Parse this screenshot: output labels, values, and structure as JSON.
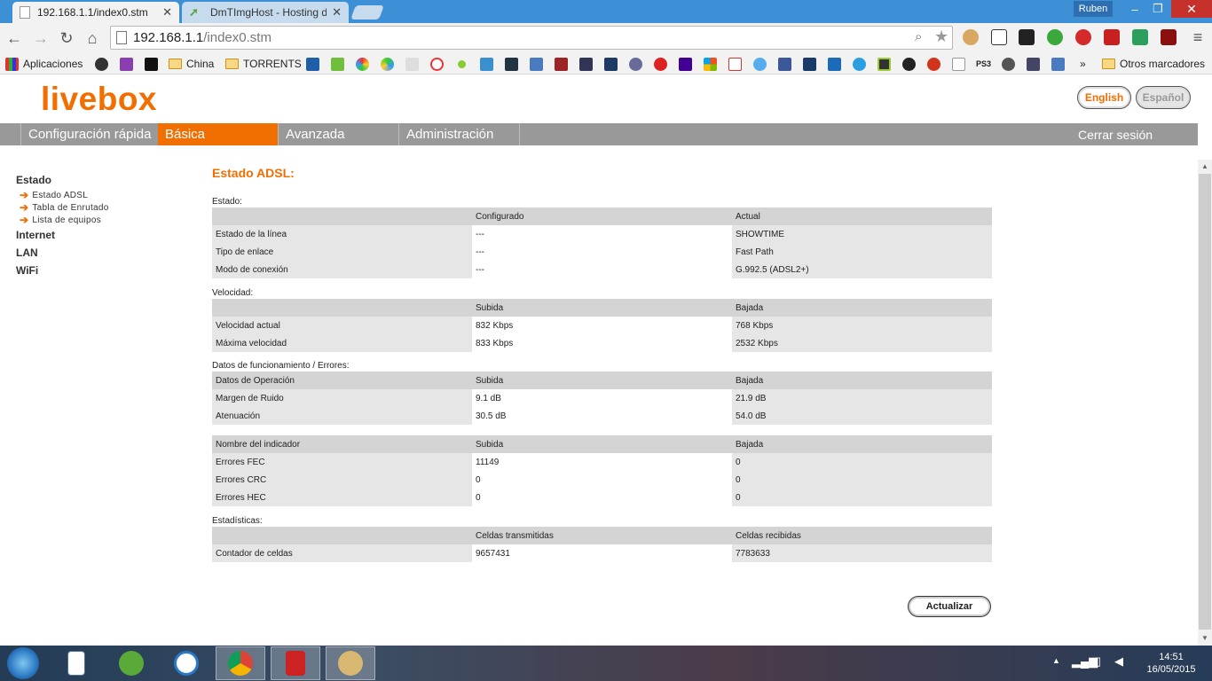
{
  "browser": {
    "tabs": [
      {
        "label": "192.168.1.1/index0.stm",
        "close": "✕"
      },
      {
        "label": "DmTImgHost - Hosting de",
        "close": "✕"
      }
    ],
    "user": "Ruben",
    "window_controls": {
      "minimize": "–",
      "maximize": "❐",
      "close": "✕"
    },
    "url": {
      "host": "192.168.1.1",
      "path": "/index0.stm"
    },
    "bookmarks": [
      {
        "label": "Aplicaciones"
      },
      {
        "label": "China"
      },
      {
        "label": "TORRENTS"
      }
    ],
    "bookmarks_more": "»",
    "other_bookmarks": "Otros marcadores"
  },
  "page": {
    "logo": "livebox",
    "lang": {
      "english": "English",
      "spanish": "Español"
    },
    "nav": {
      "rapida": "Configuración rápida",
      "basica": "Básica",
      "avanzada": "Avanzada",
      "admin": "Administración",
      "logout": "Cerrar sesión"
    },
    "sidebar": {
      "estado": "Estado",
      "sub": [
        "Estado ADSL",
        "Tabla de Enrutado",
        "Lista de equipos"
      ],
      "internet": "Internet",
      "lan": "LAN",
      "wifi": "WiFi"
    },
    "title": "Estado ADSL:",
    "estado": {
      "label": "Estado:",
      "header": [
        "",
        "Configurado",
        "Actual"
      ],
      "rows": [
        [
          "Estado de la línea",
          "---",
          "SHOWTIME"
        ],
        [
          "Tipo de enlace",
          "---",
          "Fast Path"
        ],
        [
          "Modo de conexión",
          "---",
          "G.992.5 (ADSL2+)"
        ]
      ]
    },
    "velocidad": {
      "label": "Velocidad:",
      "header": [
        "",
        "Subida",
        "Bajada"
      ],
      "rows": [
        [
          "Velocidad actual",
          "832 Kbps",
          "768 Kbps"
        ],
        [
          "Máxima velocidad",
          "833 Kbps",
          "2532 Kbps"
        ]
      ]
    },
    "funcionamiento": {
      "label": "Datos de funcionamiento / Errores:",
      "header": [
        "Datos de Operación",
        "Subida",
        "Bajada"
      ],
      "rows": [
        [
          "Margen de Ruido",
          "9.1 dB",
          "21.9 dB"
        ],
        [
          "Atenuación",
          "30.5 dB",
          "54.0 dB"
        ]
      ]
    },
    "errores": {
      "header": [
        "Nombre del indicador",
        "Subida",
        "Bajada"
      ],
      "rows": [
        [
          "Errores FEC",
          "11149",
          "0"
        ],
        [
          "Errores CRC",
          "0",
          "0"
        ],
        [
          "Errores HEC",
          "0",
          "0"
        ]
      ]
    },
    "estadisticas": {
      "label": "Estadísticas:",
      "header": [
        "",
        "Celdas transmitidas",
        "Celdas recibidas"
      ],
      "rows": [
        [
          "Contador de celdas",
          "9657431",
          "7783633"
        ]
      ]
    },
    "actualizar": "Actualizar"
  },
  "taskbar": {
    "time": "14:51",
    "date": "16/05/2015"
  },
  "colors": {
    "accent": "#f16e00",
    "nav_bg": "#999999",
    "title_bar": "#3d8fd6"
  }
}
